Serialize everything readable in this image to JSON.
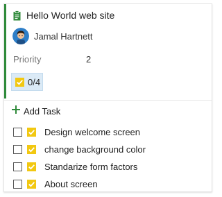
{
  "card": {
    "title": "Hello World web site",
    "title_icon": "clipboard-icon",
    "accent_color": "#2f8a3a",
    "assignee": {
      "name": "Jamal Hartnett",
      "avatar": "avatar"
    },
    "priority": {
      "label": "Priority",
      "value": "2"
    },
    "progress": {
      "text": "0/4",
      "icon": "task-check-icon"
    }
  },
  "tasks": {
    "add_label": "Add Task",
    "add_icon": "plus-icon",
    "items": [
      {
        "title": "Design welcome screen",
        "done": false
      },
      {
        "title": "change background color",
        "done": false
      },
      {
        "title": "Standarize form factors",
        "done": false
      },
      {
        "title": "About screen",
        "done": false
      }
    ]
  },
  "colors": {
    "task_yellow": "#f2c811",
    "progress_bg": "#dbeaf6"
  }
}
